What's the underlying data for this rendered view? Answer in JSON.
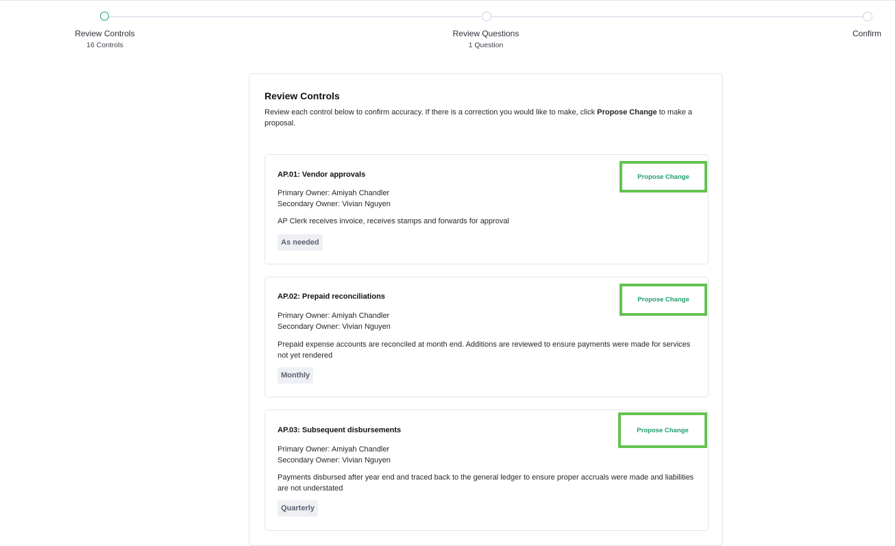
{
  "stepper": {
    "steps": [
      {
        "label": "Review Controls",
        "sub": "16 Controls",
        "active": true
      },
      {
        "label": "Review Questions",
        "sub": "1 Question",
        "active": false
      },
      {
        "label": "Confirm",
        "sub": "",
        "active": false
      }
    ]
  },
  "panel": {
    "title": "Review Controls",
    "desc_prefix": "Review each control below to confirm accuracy. If there is a correction you would like to make, click ",
    "desc_bold": "Propose Change",
    "desc_suffix": " to make a proposal."
  },
  "controls": [
    {
      "title": "AP.01: Vendor approvals",
      "primary_owner": "Primary Owner: Amiyah Chandler",
      "secondary_owner": "Secondary Owner: Vivian Nguyen",
      "description": "AP Clerk receives invoice, receives stamps and forwards for approval",
      "frequency": "As needed",
      "action_label": "Propose Change"
    },
    {
      "title": "AP.02: Prepaid reconciliations",
      "primary_owner": "Primary Owner: Amiyah Chandler",
      "secondary_owner": "Secondary Owner: Vivian Nguyen",
      "description": "Prepaid expense accounts are reconciled at month end. Additions are reviewed to ensure payments were made for services not yet rendered",
      "frequency": "Monthly",
      "action_label": "Propose Change"
    },
    {
      "title": "AP.03: Subsequent disbursements",
      "primary_owner": "Primary Owner: Amiyah Chandler",
      "secondary_owner": "Secondary Owner: Vivian Nguyen",
      "description": "Payments disbursed after year end and traced back to the general ledger to ensure proper accruals were made and liabilities are not understated",
      "frequency": "Quarterly",
      "action_label": "Propose Change"
    }
  ],
  "colors": {
    "accent_green": "#1f9d6b",
    "highlight_border": "#63c250",
    "badge_bg": "#eef0f4"
  }
}
